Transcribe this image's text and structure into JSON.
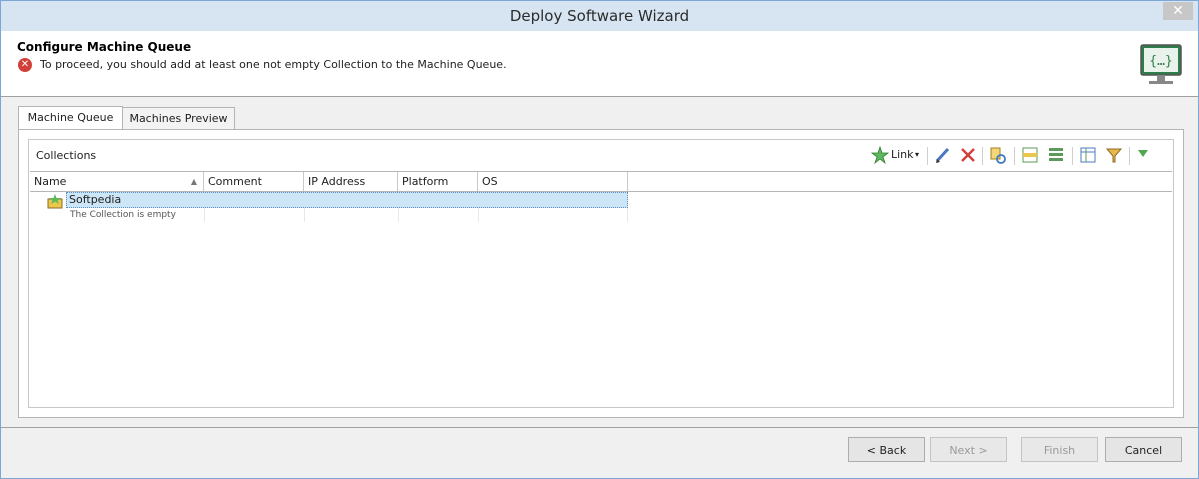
{
  "window": {
    "title": "Deploy Software Wizard",
    "close_glyph": "✕"
  },
  "header": {
    "title": "Configure Machine Queue",
    "error_message": "To proceed, you should add at least one not empty Collection to the Machine Queue.",
    "icon": "monitor-code-icon"
  },
  "tabs": [
    {
      "label": "Machine Queue",
      "active": true
    },
    {
      "label": "Machines Preview",
      "active": false
    }
  ],
  "collections": {
    "title": "Collections",
    "toolbar": {
      "link_label": "Link",
      "icons": [
        "link-star-icon",
        "edit-pencil-icon",
        "delete-x-icon",
        "refresh-copy-icon",
        "group-rows-icon",
        "list-rows-icon",
        "table-columns-icon",
        "filter-funnel-icon",
        "expand-triangle-icon"
      ]
    },
    "columns": [
      "Name",
      "Comment",
      "IP Address",
      "Platform",
      "OS"
    ],
    "rows": [
      {
        "name": "Softpedia",
        "subtext": "The Collection is empty"
      }
    ]
  },
  "buttons": {
    "back": "< Back",
    "next": "Next >",
    "finish": "Finish",
    "cancel": "Cancel"
  },
  "colors": {
    "accent": "#d7e5f2",
    "error": "#d2403a",
    "selection": "#cce5f7"
  }
}
